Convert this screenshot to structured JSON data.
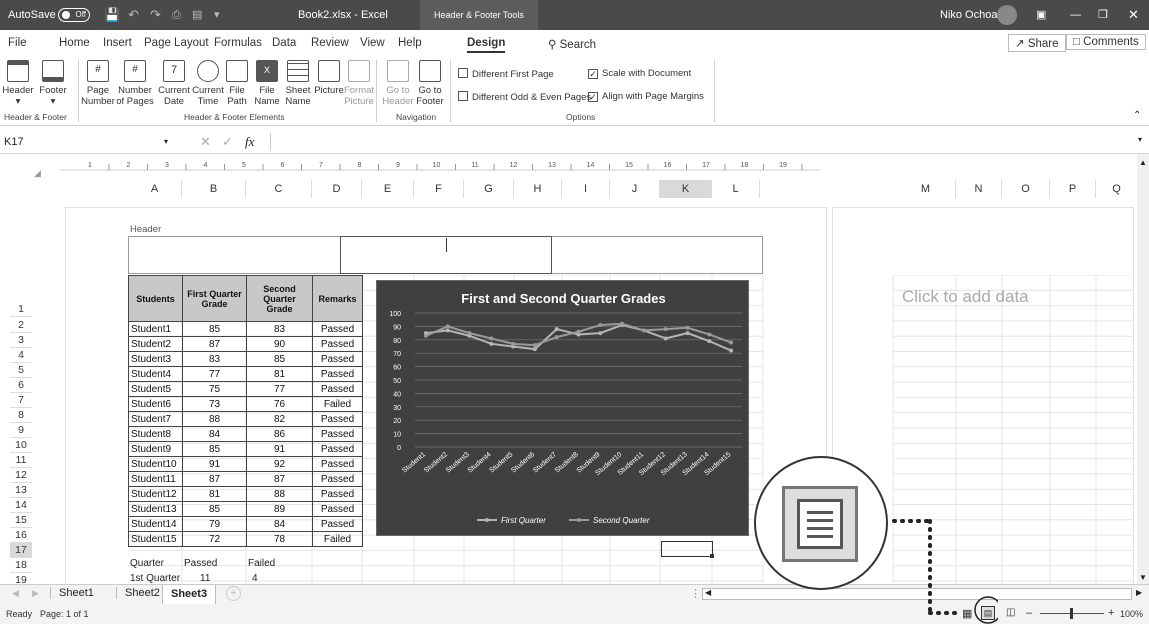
{
  "titlebar": {
    "autosave_label": "AutoSave",
    "autosave_state": "Off",
    "file_title": "Book2.xlsx - Excel",
    "context_tab": "Header & Footer Tools",
    "user_name": "Niko Ochoa"
  },
  "tabs": [
    "File",
    "Home",
    "Insert",
    "Page Layout",
    "Formulas",
    "Data",
    "Review",
    "View",
    "Help",
    "Design"
  ],
  "search_label": "Search",
  "share_label": "Share",
  "comments_label": "Comments",
  "ribbon": {
    "buttons": [
      {
        "line1": "Header",
        "line2": "",
        "icon": "header-icon"
      },
      {
        "line1": "Footer",
        "line2": "",
        "icon": "footer-icon"
      },
      {
        "line1": "Page",
        "line2": "Number",
        "icon": "page-number-icon"
      },
      {
        "line1": "Number",
        "line2": "of Pages",
        "icon": "number-of-pages-icon"
      },
      {
        "line1": "Current",
        "line2": "Date",
        "icon": "calendar-icon"
      },
      {
        "line1": "Current",
        "line2": "Time",
        "icon": "clock-icon"
      },
      {
        "line1": "File",
        "line2": "Path",
        "icon": "folder-icon"
      },
      {
        "line1": "File",
        "line2": "Name",
        "icon": "excel-file-icon"
      },
      {
        "line1": "Sheet",
        "line2": "Name",
        "icon": "sheet-icon"
      },
      {
        "line1": "Picture",
        "line2": "",
        "icon": "picture-icon"
      },
      {
        "line1": "Format",
        "line2": "Picture",
        "icon": "format-picture-icon"
      },
      {
        "line1": "Go to",
        "line2": "Header",
        "icon": "go-to-header-icon"
      },
      {
        "line1": "Go to",
        "line2": "Footer",
        "icon": "go-to-footer-icon"
      }
    ],
    "groups": [
      "Header & Footer",
      "Header & Footer Elements",
      "Navigation",
      "Options"
    ],
    "options": [
      {
        "label": "Different First Page",
        "checked": false
      },
      {
        "label": "Scale with Document",
        "checked": true
      },
      {
        "label": "Different Odd & Even Pages",
        "checked": false
      },
      {
        "label": "Align with Page Margins",
        "checked": true
      }
    ]
  },
  "formula_bar": {
    "name_box": "K17",
    "fx": "fx",
    "content": ""
  },
  "ruler_numbers": [
    "1",
    "2",
    "3",
    "4",
    "5",
    "6",
    "7",
    "8",
    "9",
    "10",
    "11",
    "12",
    "13",
    "14",
    "15",
    "16",
    "17",
    "18",
    "19"
  ],
  "columns": [
    "A",
    "B",
    "C",
    "D",
    "E",
    "F",
    "G",
    "H",
    "I",
    "J",
    "K",
    "L",
    "M",
    "N",
    "O",
    "P",
    "Q"
  ],
  "rows": [
    "1",
    "2",
    "3",
    "4",
    "5",
    "6",
    "7",
    "8",
    "9",
    "10",
    "11",
    "12",
    "13",
    "14",
    "15",
    "16",
    "17",
    "18",
    "19"
  ],
  "header_label": "Header",
  "click_to_add": "Click to add data",
  "table": {
    "headers": [
      "Students",
      "First Quarter Grade",
      "Second Quarter Grade",
      "Remarks"
    ],
    "rows": [
      [
        "Student1",
        "85",
        "83",
        "Passed"
      ],
      [
        "Student2",
        "87",
        "90",
        "Passed"
      ],
      [
        "Student3",
        "83",
        "85",
        "Passed"
      ],
      [
        "Student4",
        "77",
        "81",
        "Passed"
      ],
      [
        "Student5",
        "75",
        "77",
        "Passed"
      ],
      [
        "Student6",
        "73",
        "76",
        "Failed"
      ],
      [
        "Student7",
        "88",
        "82",
        "Passed"
      ],
      [
        "Student8",
        "84",
        "86",
        "Passed"
      ],
      [
        "Student9",
        "85",
        "91",
        "Passed"
      ],
      [
        "Student10",
        "91",
        "92",
        "Passed"
      ],
      [
        "Student11",
        "87",
        "87",
        "Passed"
      ],
      [
        "Student12",
        "81",
        "88",
        "Passed"
      ],
      [
        "Student13",
        "85",
        "89",
        "Passed"
      ],
      [
        "Student14",
        "79",
        "84",
        "Passed"
      ],
      [
        "Student15",
        "72",
        "78",
        "Failed"
      ]
    ]
  },
  "summary": {
    "headers": [
      "Quarter",
      "Passed",
      "Failed"
    ],
    "row": [
      "1st Quarter",
      "11",
      "4"
    ]
  },
  "chart_data": {
    "type": "line",
    "title": "First and Second Quarter Grades",
    "categories": [
      "Student1",
      "Student2",
      "Student3",
      "Student4",
      "Student5",
      "Student6",
      "Student7",
      "Student8",
      "Student9",
      "Student10",
      "Student11",
      "Student12",
      "Student13",
      "Student14",
      "Student15"
    ],
    "series": [
      {
        "name": "First Quarter",
        "values": [
          85,
          87,
          83,
          77,
          75,
          73,
          88,
          84,
          85,
          91,
          87,
          81,
          85,
          79,
          72
        ]
      },
      {
        "name": "Second Quarter",
        "values": [
          83,
          90,
          85,
          81,
          77,
          76,
          82,
          86,
          91,
          92,
          87,
          88,
          89,
          84,
          78
        ]
      }
    ],
    "ylim": [
      0,
      100
    ],
    "yticks": [
      "0",
      "10",
      "20",
      "30",
      "40",
      "50",
      "60",
      "70",
      "80",
      "90",
      "100"
    ],
    "legend": "bottom",
    "grid": true
  },
  "sheet_tabs": [
    "Sheet1",
    "Sheet2",
    "Sheet3"
  ],
  "active_sheet": "Sheet3",
  "status": {
    "ready": "Ready",
    "page": "Page: 1 of 1",
    "zoom": "100%"
  }
}
